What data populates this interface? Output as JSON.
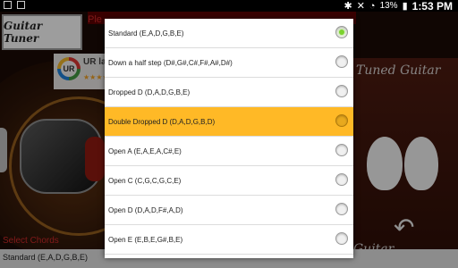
{
  "status_bar": {
    "battery_percent": "13%",
    "time": "1:53 PM"
  },
  "background_app": {
    "logo": "Guitar Tuner",
    "header_text": "Ple",
    "ur_badge": {
      "text": "UR la",
      "logo_text": "UR",
      "stars": "★★★★"
    },
    "tuned_title": "Tuned Guitar",
    "guitar_title": "Guitar",
    "select_label": "Select Chords",
    "selected_chord": "Standard (E,A,D,G,B,E)"
  },
  "tunings": [
    {
      "label": "Standard (E,A,D,G,B,E)",
      "checked": true,
      "highlighted": false
    },
    {
      "label": "Down a half step (D#,G#,C#,F#,A#,D#)",
      "checked": false,
      "highlighted": false
    },
    {
      "label": "Dropped D (D,A,D,G,B,E)",
      "checked": false,
      "highlighted": false
    },
    {
      "label": "Double Dropped D (D,A,D,G,B,D)",
      "checked": false,
      "highlighted": true
    },
    {
      "label": "Open A (E,A,E,A,C#,E)",
      "checked": false,
      "highlighted": false
    },
    {
      "label": "Open C (C,G,C,G,C,E)",
      "checked": false,
      "highlighted": false
    },
    {
      "label": "Open D (D,A,D,F#,A,D)",
      "checked": false,
      "highlighted": false
    },
    {
      "label": "Open E (E,B,E,G#,B,E)",
      "checked": false,
      "highlighted": false
    }
  ],
  "colors": {
    "highlight": "#ffb926",
    "radio_checked": "#7cd32f"
  }
}
